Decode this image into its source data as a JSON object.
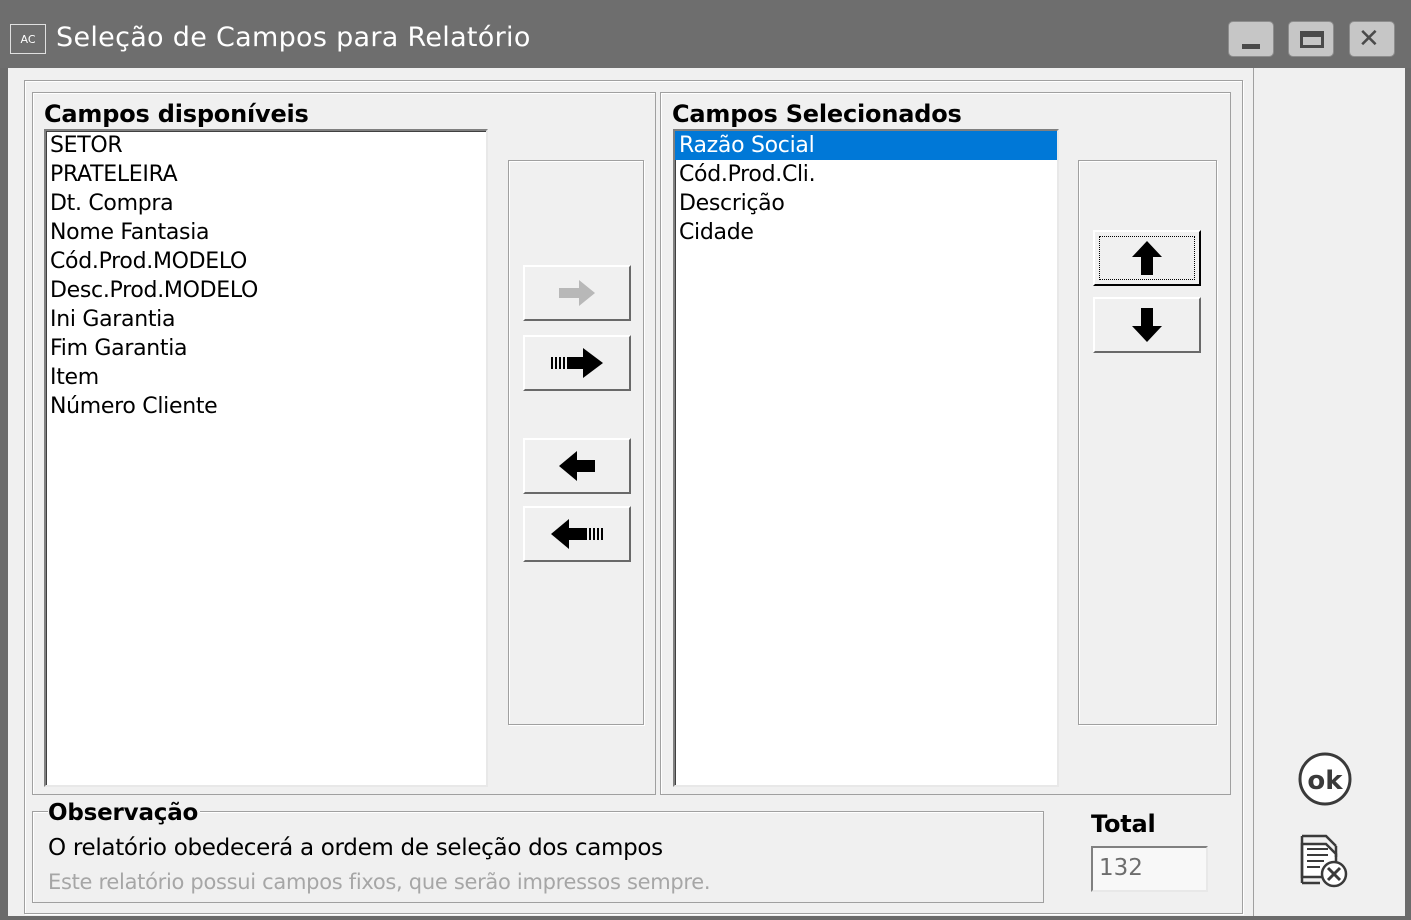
{
  "window": {
    "app_icon": "AC",
    "title": "Seleção de Campos para Relatório",
    "controls": [
      "minimize-icon",
      "maximize-icon",
      "close-icon"
    ],
    "titlebar_color": "#6e6e6e"
  },
  "available": {
    "label": "Campos disponíveis",
    "items": [
      "SETOR",
      "PRATELEIRA",
      "Dt. Compra",
      "Nome Fantasia",
      "Cód.Prod.MODELO",
      "Desc.Prod.MODELO",
      "Ini Garantia",
      "Fim Garantia",
      "Item",
      "Número Cliente"
    ]
  },
  "transfer_buttons": [
    {
      "name": "add-selected-button",
      "icon": "arrow-right-icon",
      "enabled": false
    },
    {
      "name": "add-all-button",
      "icon": "arrow-right-all-icon",
      "enabled": true
    },
    {
      "name": "remove-selected-button",
      "icon": "arrow-left-icon",
      "enabled": true
    },
    {
      "name": "remove-all-button",
      "icon": "arrow-left-all-icon",
      "enabled": true
    }
  ],
  "selected": {
    "label": "Campos Selecionados",
    "items": [
      "Razão Social",
      "Cód.Prod.Cli.",
      "Descrição",
      "Cidade"
    ],
    "selected_index": 0,
    "highlight_color": "#0078d7"
  },
  "order_buttons": [
    {
      "name": "move-up-button",
      "icon": "arrow-up-icon"
    },
    {
      "name": "move-down-button",
      "icon": "arrow-down-icon"
    }
  ],
  "observation": {
    "label": "Observação",
    "line1": "O relatório obedecerá a ordem de seleção dos campos",
    "line2": "Este relatório possui campos fixos, que serão impressos sempre."
  },
  "total": {
    "label": "Total",
    "value": "132"
  },
  "actions": {
    "ok_icon": "ok-icon",
    "cancel_icon": "cancel-report-icon"
  }
}
